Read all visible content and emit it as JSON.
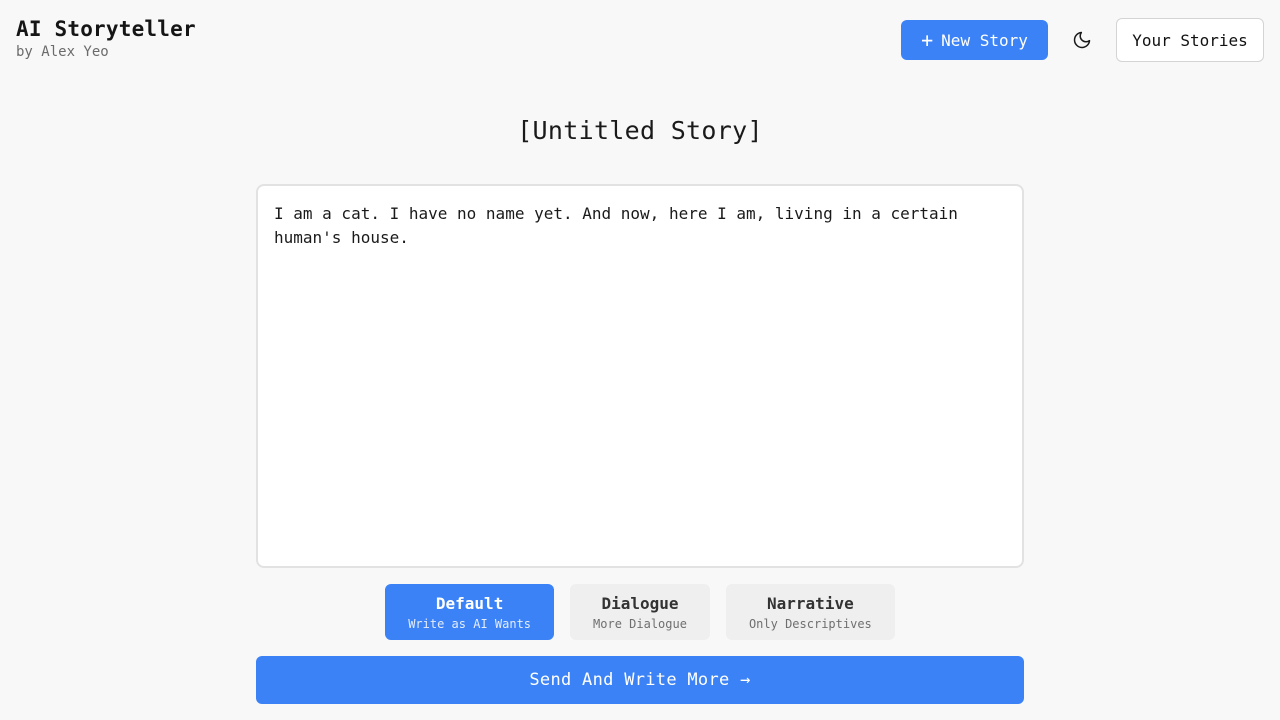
{
  "header": {
    "app_title": "AI Storyteller",
    "byline": "by Alex Yeo",
    "new_story_plus": "+",
    "new_story_label": "New Story",
    "theme_icon": "moon-icon",
    "your_stories_label": "Your Stories"
  },
  "story": {
    "title": "[Untitled Story]",
    "text": "I am a cat. I have no name yet. And now, here I am, living in a certain human's house."
  },
  "modes": [
    {
      "name": "Default",
      "description": "Write as AI Wants",
      "active": true
    },
    {
      "name": "Dialogue",
      "description": "More Dialogue",
      "active": false
    },
    {
      "name": "Narrative",
      "description": "Only Descriptives",
      "active": false
    }
  ],
  "actions": {
    "send_label": "Send And Write More →"
  },
  "colors": {
    "accent": "#3b82f6",
    "background": "#f8f8f8"
  }
}
